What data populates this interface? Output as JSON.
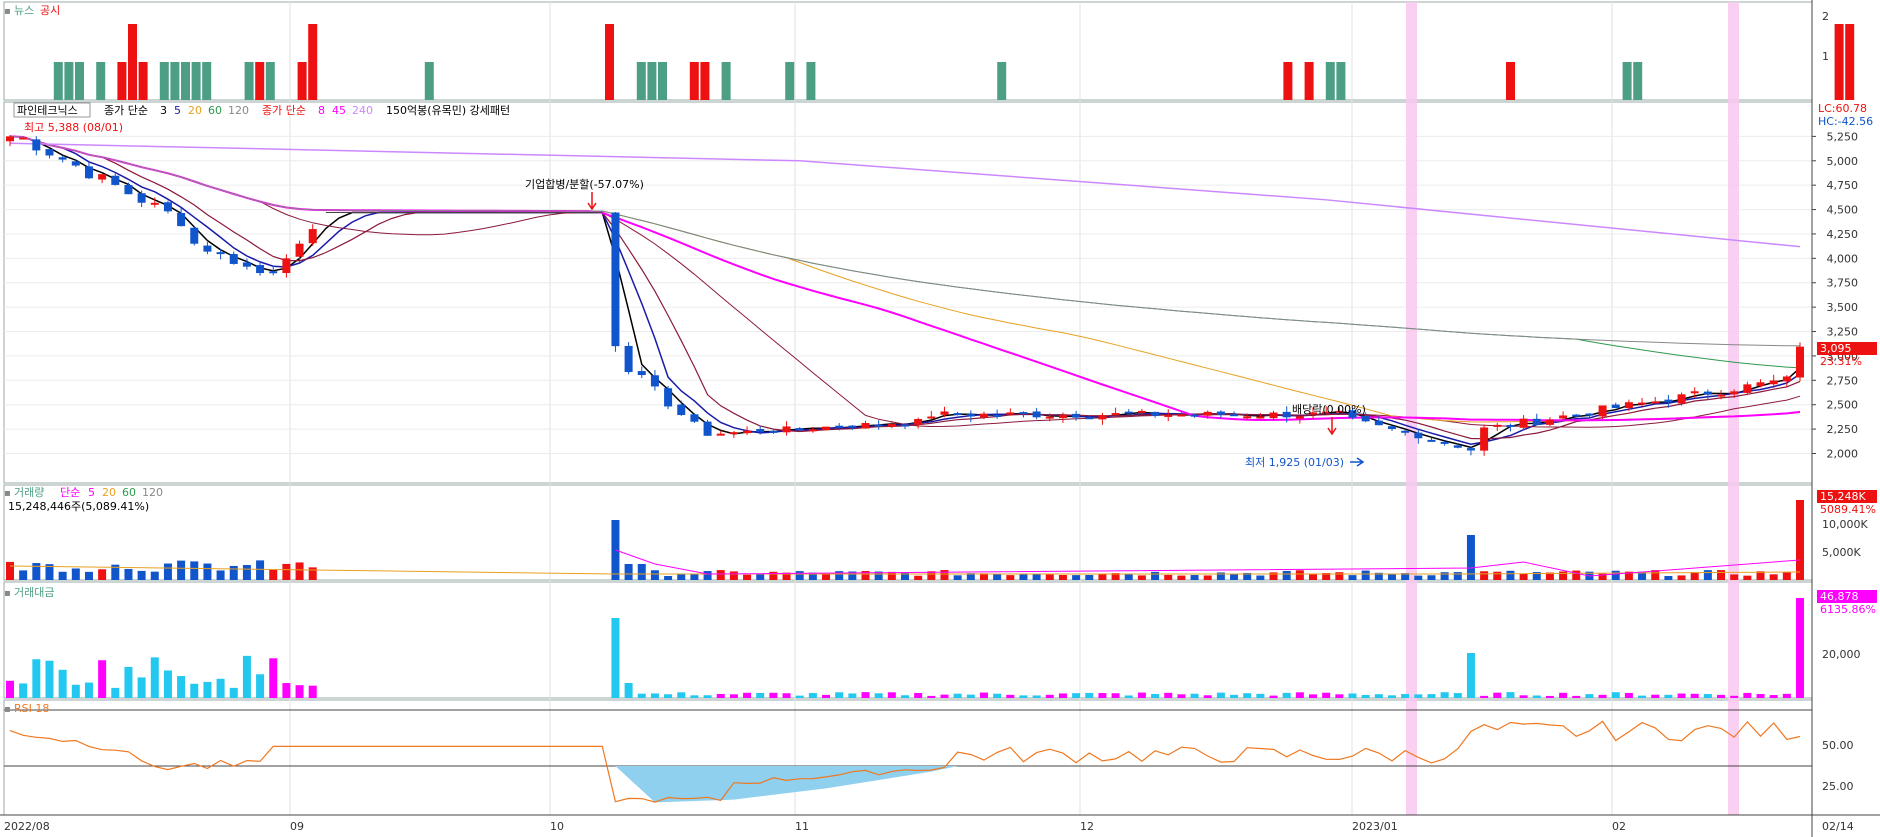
{
  "stock_name": "파인테크닉스",
  "panels": {
    "news": {
      "legend": [
        "뉴스",
        "공시"
      ],
      "y_ticks": [
        "2",
        "1"
      ]
    },
    "price": {
      "legend": {
        "ma_label": "종가 단순",
        "ma_periods": [
          "3",
          "5",
          "20",
          "60",
          "120"
        ],
        "ma2_label": "종가 단순",
        "ma2_periods": [
          "8",
          "45",
          "240"
        ],
        "extra": "150억봉(유목민) 강세패턴"
      },
      "y_ticks": [
        "5,250",
        "5,000",
        "4,750",
        "4,500",
        "4,250",
        "4,000",
        "3,750",
        "3,500",
        "3,250",
        "3,000",
        "2,750",
        "2,500",
        "2,250",
        "2,000"
      ],
      "lc": "LC:60.78",
      "hc": "HC:-42.56",
      "last_price": "3,095",
      "last_change": "23.31%",
      "annotations": {
        "high": "최고 5,388 (08/01)",
        "low": "최저 1,925 (01/03)",
        "merge": "기업합병/분할(-57.07%)",
        "dividend": "배당락(0.00%)"
      }
    },
    "volume": {
      "legend": {
        "label": "거래량",
        "ma_label": "단순",
        "periods": [
          "5",
          "20",
          "60",
          "120"
        ]
      },
      "info": "15,248,446주(5,089.41%)",
      "y_ticks": [
        "10,000K",
        "5,000K"
      ],
      "last_value": "15,248K",
      "last_pct": "5089.41%"
    },
    "amount": {
      "legend": "거래대금",
      "y_ticks": [
        "20,000"
      ],
      "last_value": "46,878",
      "last_pct": "6135.86%"
    },
    "rsi": {
      "legend": "RSI 18",
      "y_ticks": [
        "50.00",
        "25.00"
      ]
    }
  },
  "x_labels": [
    "2022/08",
    "09",
    "10",
    "11",
    "12",
    "2023/01",
    "02",
    "02/14"
  ],
  "colors": {
    "up": "#EE1111",
    "down": "#1155CC",
    "news": "#4C9F85",
    "disclosure": "#EE1111",
    "ma3": "#000000",
    "ma5": "#1A1AA8",
    "ma20": "#8B1A3A",
    "ma60": "#E8A020",
    "ma120": "#2E9A4E",
    "ma8": "#FF00FF",
    "ma45": "#888888",
    "ma240": "#CC88FF",
    "amount": "#22C8F0",
    "amount_up": "#FF00FF",
    "rsi": "#F07820",
    "highlight": "#F8C8F0"
  },
  "chart_data": {
    "type": "candlestick",
    "title": "파인테크닉스",
    "x_start": "2022-08-01",
    "x_end": "2023-02-14",
    "y_range": [
      1800,
      5500
    ],
    "key_points": [
      {
        "date": "2022-08-01",
        "high": 5388
      },
      {
        "date": "2022-10-04",
        "open": 4470,
        "close": 3100,
        "note": "기업합병/분할(-57.07%)"
      },
      {
        "date": "2023-01-03",
        "low": 1925
      },
      {
        "date": "2023-02-14",
        "close": 3095,
        "change_pct": 23.31,
        "volume": 15248446
      }
    ]
  }
}
